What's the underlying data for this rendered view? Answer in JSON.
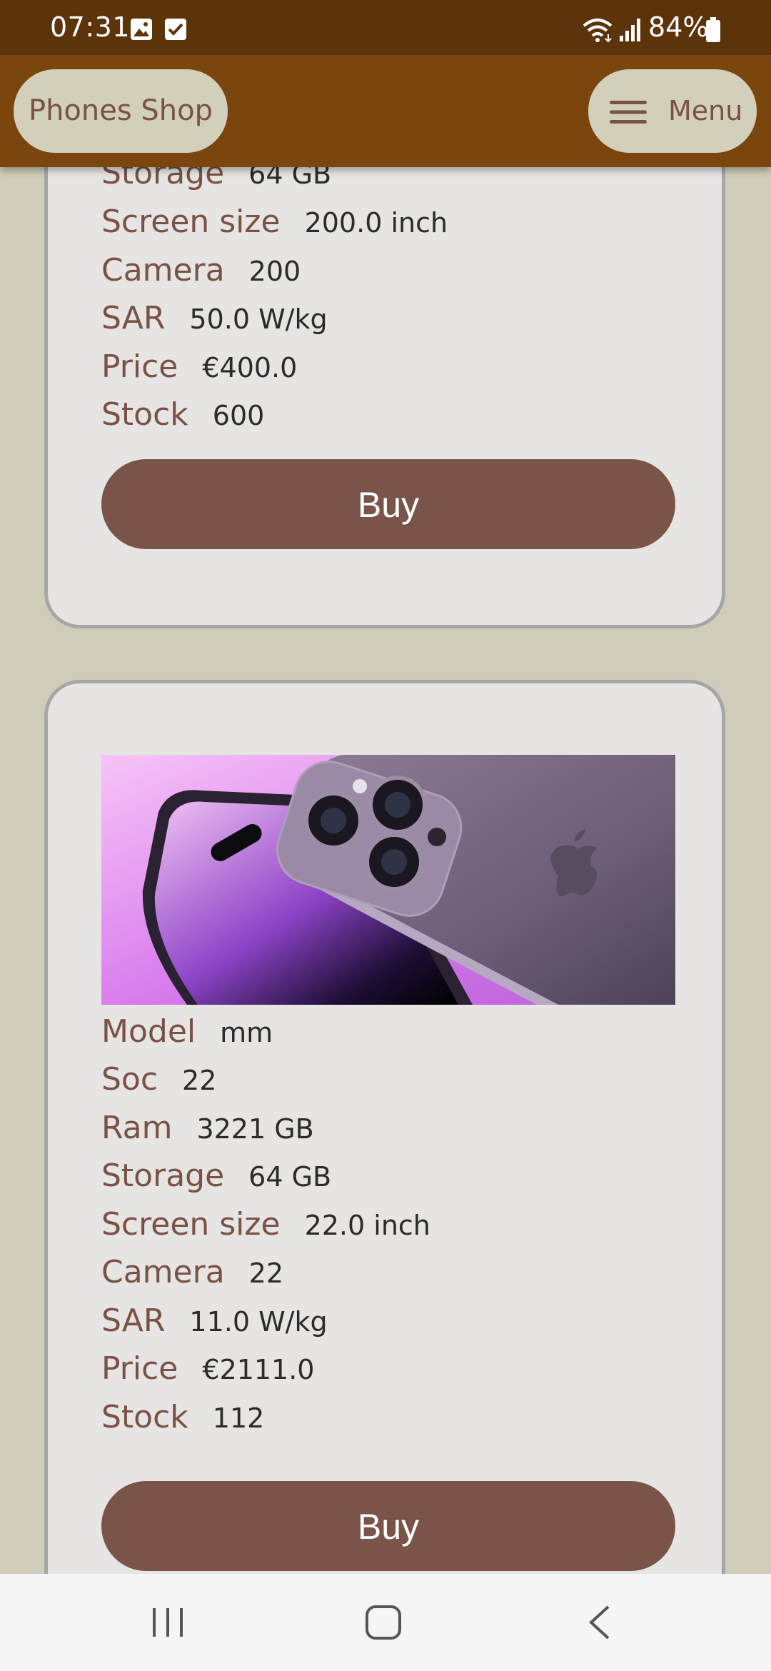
{
  "status_bar": {
    "time": "07:31",
    "battery": "84%",
    "icons": [
      "gallery-icon",
      "checkbox-icon",
      "wifi-icon",
      "signal-icon",
      "battery-icon"
    ]
  },
  "app_bar": {
    "brand": "Phones Shop",
    "menu_label": "Menu",
    "menu_icon": "hamburger-icon"
  },
  "cards": [
    {
      "specs": [
        {
          "label": "Storage",
          "value": "64 GB"
        },
        {
          "label": "Screen size",
          "value": "200.0 inch"
        },
        {
          "label": "Camera",
          "value": "200"
        },
        {
          "label": "SAR",
          "value": "50.0 W/kg"
        },
        {
          "label": "Price",
          "value": "€400.0"
        },
        {
          "label": "Stock",
          "value": "600"
        }
      ],
      "buy_label": "Buy"
    },
    {
      "image": "phone-image",
      "specs": [
        {
          "label": "Model",
          "value": "mm"
        },
        {
          "label": "Soc",
          "value": "22"
        },
        {
          "label": "Ram",
          "value": "3221 GB"
        },
        {
          "label": "Storage",
          "value": "64 GB"
        },
        {
          "label": "Screen size",
          "value": "22.0 inch"
        },
        {
          "label": "Camera",
          "value": "22"
        },
        {
          "label": "SAR",
          "value": "11.0 W/kg"
        },
        {
          "label": "Price",
          "value": "€2111.0"
        },
        {
          "label": "Stock",
          "value": "112"
        }
      ],
      "buy_label": "Buy"
    }
  ],
  "nav_bar": {
    "icons": [
      "recent-apps-icon",
      "home-icon",
      "back-icon"
    ]
  },
  "colors": {
    "status_bar": "#5d330a",
    "app_bar": "#7b450e",
    "pill": "#d2cfbb",
    "page_background": "#cfcdb9",
    "card_background": "#e6e5e3",
    "card_border": "#a6a6a6",
    "label_text": "#7a5245",
    "buy_button": "#7a5448"
  }
}
